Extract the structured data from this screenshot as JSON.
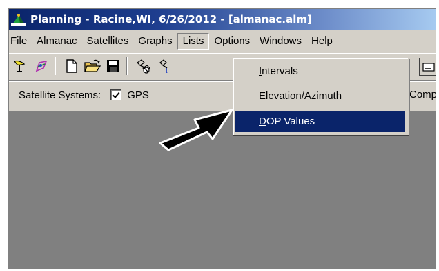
{
  "window": {
    "title": "Planning - Racine,WI, 6/26/2012 - [almanac.alm]"
  },
  "menubar": {
    "items": [
      "File",
      "Almanac",
      "Satellites",
      "Graphs",
      "Lists",
      "Options",
      "Windows",
      "Help"
    ],
    "active": "Lists"
  },
  "toolbar": {
    "icons": [
      "antenna-icon",
      "satellite-icon",
      "new-file-icon",
      "open-folder-icon",
      "save-icon",
      "satellite-delete-icon",
      "satellite-info-icon"
    ]
  },
  "options_bar": {
    "label": "Satellite Systems:",
    "gps_label": "GPS",
    "gps_checked": true,
    "truncated_right": "Comp"
  },
  "lists_menu": {
    "items": [
      {
        "pre": "",
        "accel": "I",
        "post": "ntervals"
      },
      {
        "pre": "",
        "accel": "E",
        "post": "levation/Azimuth"
      },
      {
        "pre": "",
        "accel": "D",
        "post": "OP Values"
      }
    ],
    "selected_index": 2
  },
  "colors": {
    "title_start": "#0a246a",
    "title_end": "#a6caf0",
    "face": "#d4d0c8",
    "workspace": "#808080",
    "highlight": "#0a246a"
  }
}
